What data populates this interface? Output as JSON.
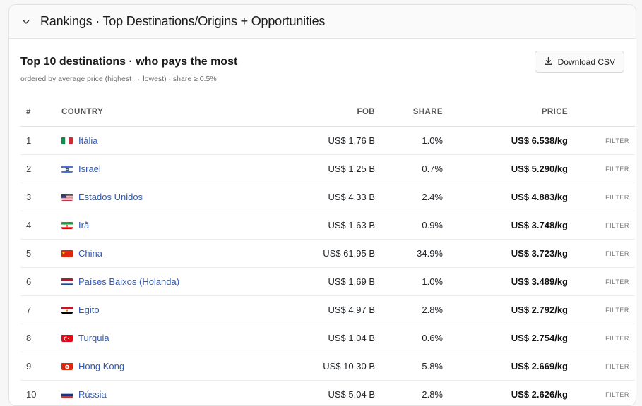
{
  "section": {
    "title": "Rankings · Top Destinations/Origins + Opportunities"
  },
  "card": {
    "title": "Top 10 destinations · who pays the most",
    "subtitle": "ordered by average price (highest → lowest) · share ≥ 0.5%",
    "download_label": "Download CSV"
  },
  "table": {
    "headers": {
      "rank": "#",
      "country": "COUNTRY",
      "fob": "FOB",
      "share": "SHARE",
      "price": "PRICE"
    },
    "rows": [
      {
        "rank": "1",
        "country": "Itália",
        "flag": "italy",
        "fob": "US$ 1.76 B",
        "share": "1.0%",
        "price": "US$ 6.538/kg",
        "action": "FILTER"
      },
      {
        "rank": "2",
        "country": "Israel",
        "flag": "israel",
        "fob": "US$ 1.25 B",
        "share": "0.7%",
        "price": "US$ 5.290/kg",
        "action": "FILTER"
      },
      {
        "rank": "3",
        "country": "Estados Unidos",
        "flag": "usa",
        "fob": "US$ 4.33 B",
        "share": "2.4%",
        "price": "US$ 4.883/kg",
        "action": "FILTER"
      },
      {
        "rank": "4",
        "country": "Irã",
        "flag": "iran",
        "fob": "US$ 1.63 B",
        "share": "0.9%",
        "price": "US$ 3.748/kg",
        "action": "FILTER"
      },
      {
        "rank": "5",
        "country": "China",
        "flag": "china",
        "fob": "US$ 61.95 B",
        "share": "34.9%",
        "price": "US$ 3.723/kg",
        "action": "FILTER"
      },
      {
        "rank": "6",
        "country": "Países Baixos (Holanda)",
        "flag": "netherlands",
        "fob": "US$ 1.69 B",
        "share": "1.0%",
        "price": "US$ 3.489/kg",
        "action": "FILTER"
      },
      {
        "rank": "7",
        "country": "Egito",
        "flag": "egypt",
        "fob": "US$ 4.97 B",
        "share": "2.8%",
        "price": "US$ 2.792/kg",
        "action": "FILTER"
      },
      {
        "rank": "8",
        "country": "Turquia",
        "flag": "turkey",
        "fob": "US$ 1.04 B",
        "share": "0.6%",
        "price": "US$ 2.754/kg",
        "action": "FILTER"
      },
      {
        "rank": "9",
        "country": "Hong Kong",
        "flag": "hongkong",
        "fob": "US$ 10.30 B",
        "share": "5.8%",
        "price": "US$ 2.669/kg",
        "action": "FILTER"
      },
      {
        "rank": "10",
        "country": "Rússia",
        "flag": "russia",
        "fob": "US$ 5.04 B",
        "share": "2.8%",
        "price": "US$ 2.626/kg",
        "action": "FILTER"
      }
    ]
  },
  "colors": {
    "link": "#2f59b8",
    "border": "#e3e3e3",
    "header_bg": "#fafafa"
  },
  "icons": {
    "collapse": "chevron-down-icon",
    "download": "download-icon"
  }
}
